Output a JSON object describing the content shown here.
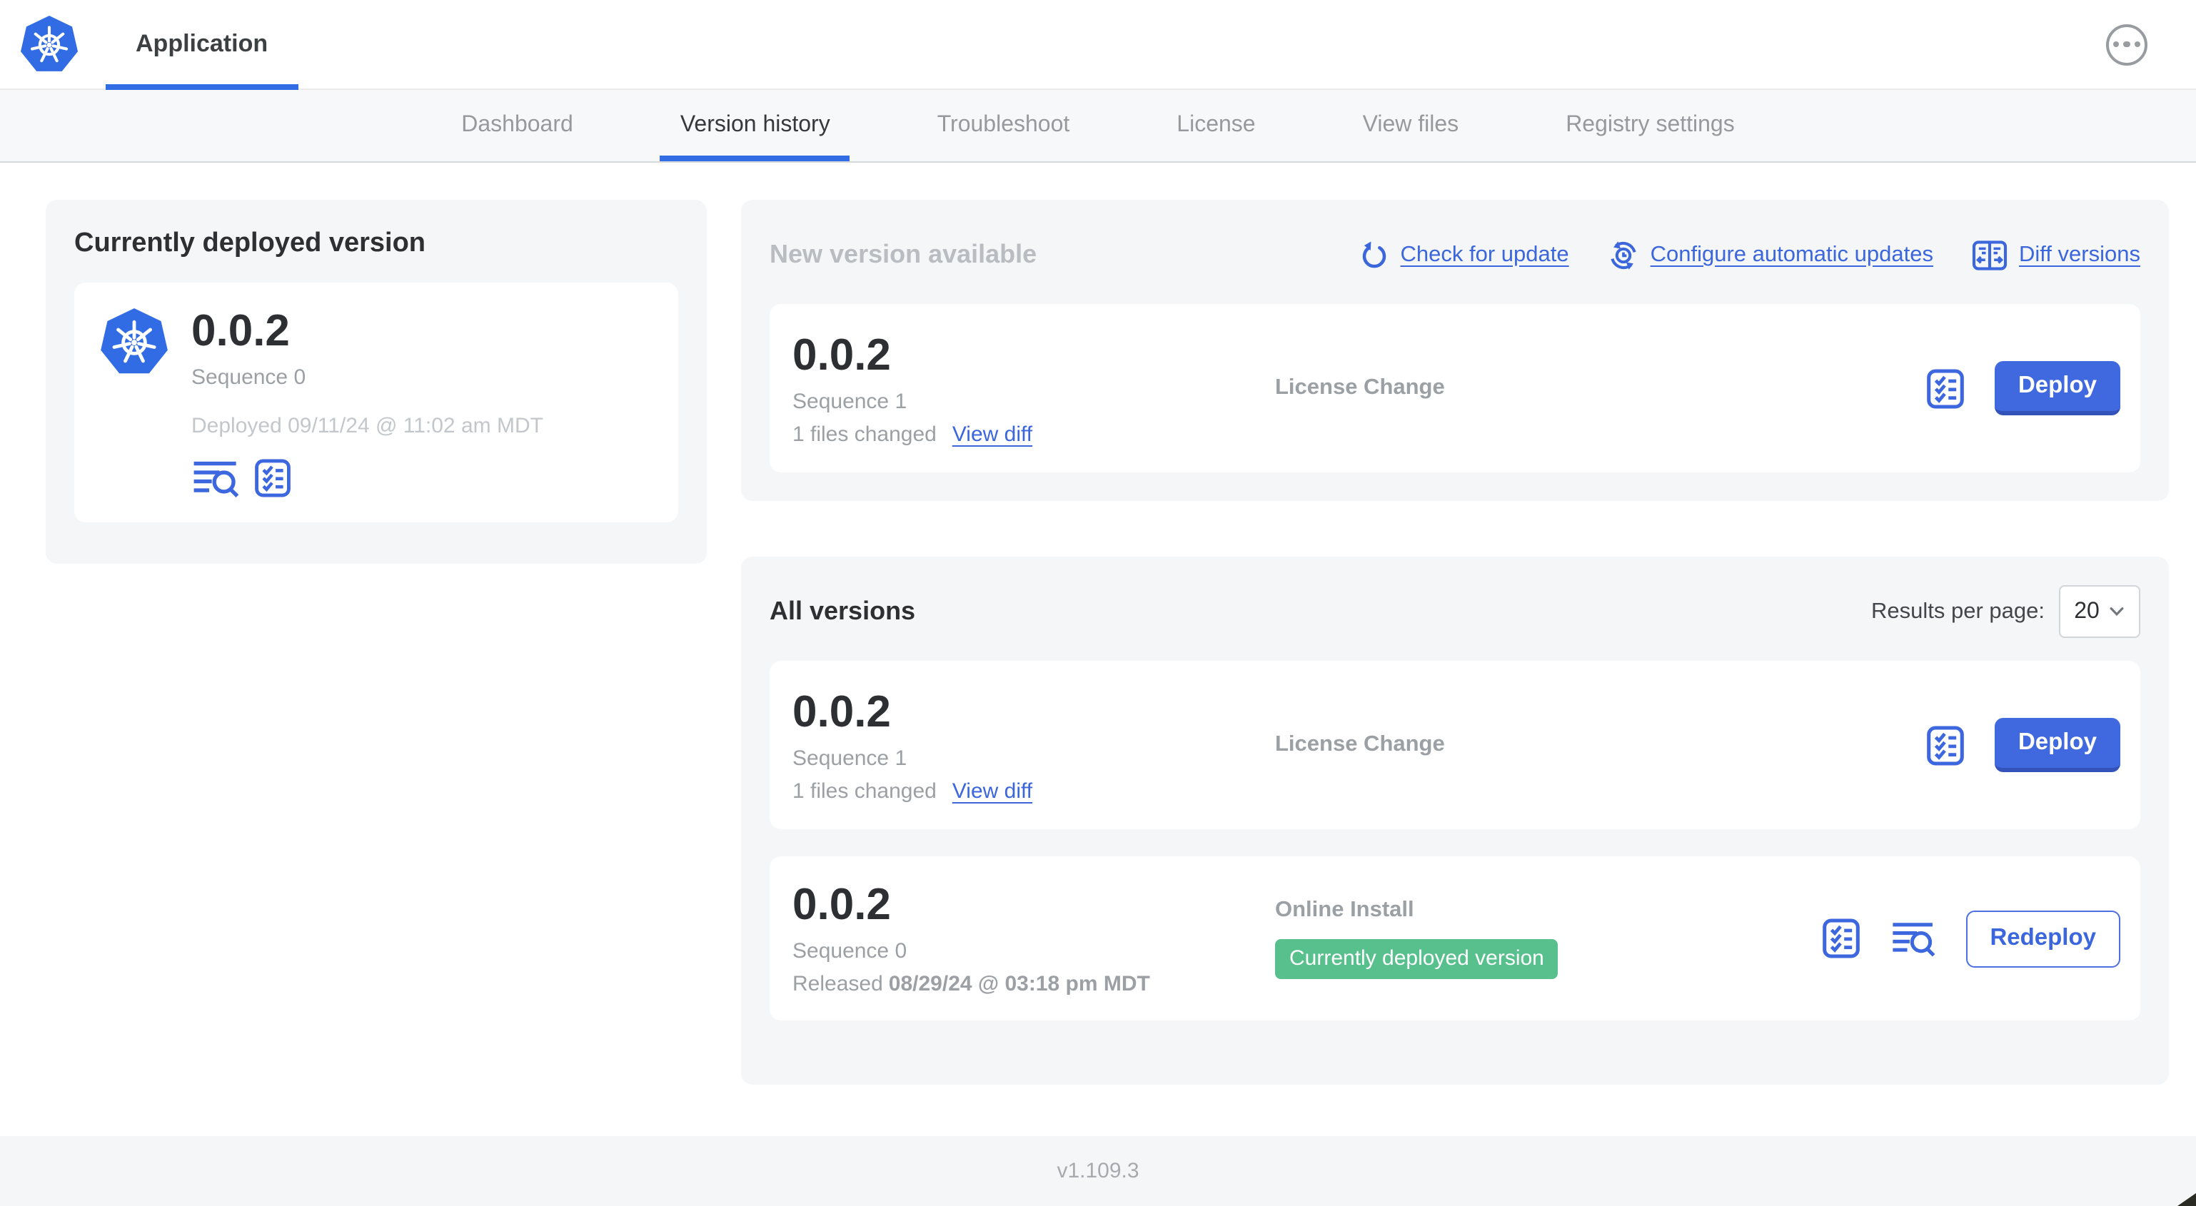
{
  "header": {
    "app_title": "Application"
  },
  "nav": {
    "tabs": [
      {
        "label": "Dashboard",
        "active": false
      },
      {
        "label": "Version history",
        "active": true
      },
      {
        "label": "Troubleshoot",
        "active": false
      },
      {
        "label": "License",
        "active": false
      },
      {
        "label": "View files",
        "active": false
      },
      {
        "label": "Registry settings",
        "active": false
      }
    ]
  },
  "currently_deployed": {
    "title": "Currently deployed version",
    "version": "0.0.2",
    "sequence": "Sequence 0",
    "deployed_at": "Deployed 09/11/24 @ 11:02 am MDT"
  },
  "new_version": {
    "title": "New version available",
    "actions": [
      {
        "label": "Check for update",
        "icon": "refresh-icon"
      },
      {
        "label": "Configure automatic updates",
        "icon": "auto-update-clock-icon"
      },
      {
        "label": "Diff versions",
        "icon": "diff-columns-icon"
      }
    ],
    "row": {
      "version": "0.0.2",
      "sequence": "Sequence 1",
      "files_changed": "1 files changed",
      "view_diff_label": "View diff",
      "source": "License Change",
      "deploy_label": "Deploy"
    }
  },
  "all_versions": {
    "title": "All versions",
    "results_per_page_label": "Results per page:",
    "results_per_page_value": "20",
    "rows": [
      {
        "version": "0.0.2",
        "sequence": "Sequence 1",
        "files_changed": "1 files changed",
        "view_diff_label": "View diff",
        "source": "License Change",
        "action_label": "Deploy"
      },
      {
        "version": "0.0.2",
        "sequence": "Sequence 0",
        "released_prefix": "Released",
        "released_date": "08/29/24 @ 03:18 pm MDT",
        "source": "Online Install",
        "badge": "Currently deployed version",
        "action_label": "Redeploy"
      }
    ]
  },
  "footer": {
    "version": "v1.109.3"
  },
  "icons": {
    "app_logo": "kubernetes-logo-icon",
    "header_menu": "ellipsis-menu-icon",
    "check_for_update": "refresh-icon",
    "configure_automatic_updates": "auto-update-clock-icon",
    "diff_versions": "diff-columns-icon",
    "version_checks": "preflight-checklist-icon",
    "version_logs": "view-logs-icon",
    "results_select": "chevron-down-icon"
  },
  "colors": {
    "accent_blue": "#3b66dc",
    "button_blue": "#4169df",
    "kubernetes_blue": "#326ce5",
    "active_tab_underline": "#326de6",
    "badge_green": "#57c08d",
    "panel_gray": "#f4f6f8",
    "muted_text": "#9ca0a4"
  }
}
